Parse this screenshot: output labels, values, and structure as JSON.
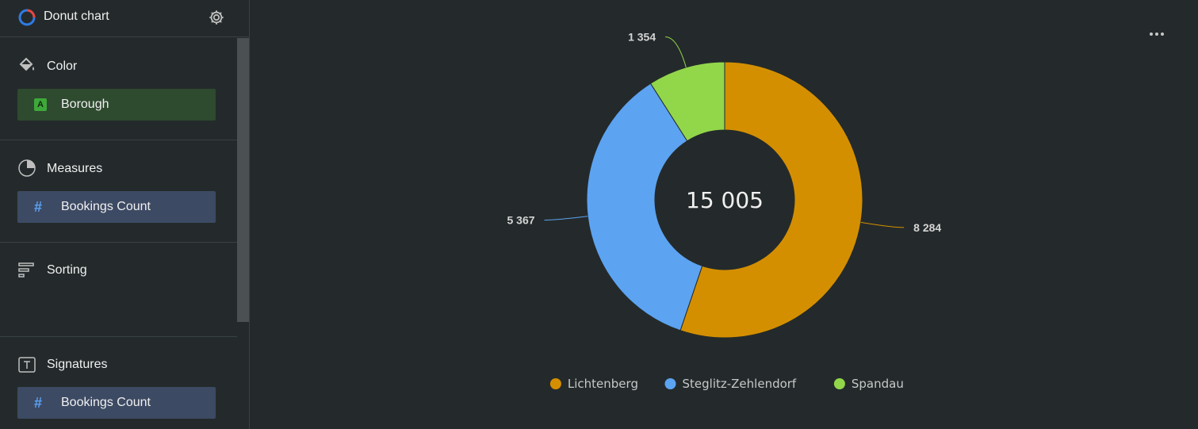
{
  "sidebar": {
    "title": "Donut chart",
    "sections": {
      "color": {
        "label": "Color",
        "chip": "Borough",
        "chip_badge": "A"
      },
      "measures": {
        "label": "Measures",
        "chip": "Bookings Count"
      },
      "sorting": {
        "label": "Sorting"
      },
      "signatures": {
        "label": "Signatures",
        "chip": "Bookings Count"
      }
    }
  },
  "colors": {
    "Lichtenberg": "#d48f00",
    "Steglitz-Zehlendorf": "#5ca3f2",
    "Spandau": "#92d74a"
  },
  "chart_data": {
    "type": "pie",
    "donut": true,
    "total_label": "15 005",
    "categories": [
      "Lichtenberg",
      "Steglitz-Zehlendorf",
      "Spandau"
    ],
    "values": [
      8284,
      5367,
      1354
    ],
    "value_labels": [
      "8 284",
      "5 367",
      "1 354"
    ],
    "legend_position": "bottom"
  }
}
